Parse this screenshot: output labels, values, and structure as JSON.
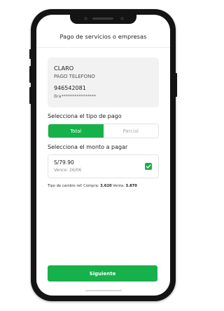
{
  "header": {
    "title": "Pago de servicios o empresas"
  },
  "service_card": {
    "company": "CLARO",
    "service_type": "PAGO TELEFONO",
    "phone_number": "946542081",
    "holder_masked": "Bra****************"
  },
  "payment_type": {
    "label": "Selecciona el tipo de pago",
    "options": [
      "Total",
      "Parcial"
    ],
    "selected": "Total"
  },
  "amount": {
    "label": "Selecciona el monto a pagar",
    "value": "S/79.90",
    "due_date": "Vence: 26/06",
    "checked": true
  },
  "exchange_rate": {
    "prefix": "Tipo de cambio ref. Compra:",
    "buy": "3.620",
    "sell_label": "Venta:",
    "sell": "3.870"
  },
  "footer": {
    "next_label": "Siguiente"
  },
  "colors": {
    "accent": "#16b14a",
    "frame": "#141414",
    "card_bg": "#f2f2f2"
  }
}
